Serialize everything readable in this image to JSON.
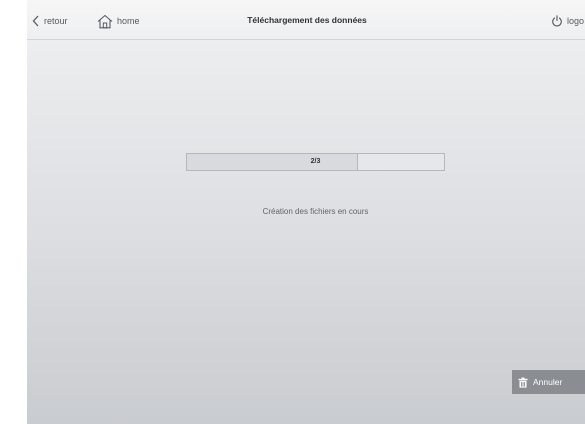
{
  "header": {
    "back_label": "retour",
    "home_label": "home",
    "title": "Téléchargement des données",
    "logout_label": "logo"
  },
  "progress": {
    "text": "2/3",
    "current": 2,
    "total": 3
  },
  "status_text": "Création des fichiers en cours",
  "cancel_label": "Annuler",
  "icons": {
    "back": "chevron-left-icon",
    "home": "home-icon",
    "logout": "power-icon",
    "cancel": "trash-icon"
  }
}
